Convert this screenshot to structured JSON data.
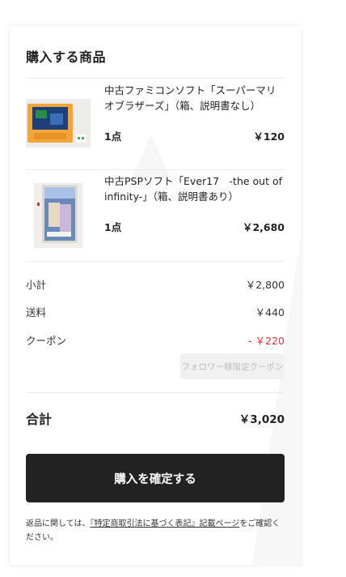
{
  "section_title": "購入する商品",
  "items": [
    {
      "name": "中古ファミコンソフト「スーパーマリオブラザーズ」（箱、説明書なし）",
      "qty": "1点",
      "price": "￥120",
      "image": "famicom-cartridge-photo"
    },
    {
      "name": "中古PSPソフト「Ever17　-the out of infinity-」（箱、説明書あり）",
      "qty": "1点",
      "price": "￥2,680",
      "image": "psp-game-case-photo"
    }
  ],
  "summary": {
    "subtotal_label": "小計",
    "subtotal_value": "￥2,800",
    "shipping_label": "送料",
    "shipping_value": "￥440",
    "coupon_label": "クーポン",
    "coupon_value": "- ￥220",
    "coupon_button": "フォロワー様限定クーポン"
  },
  "total": {
    "label": "合計",
    "value": "￥3,020"
  },
  "confirm_button": "購入を確定する",
  "notice": {
    "prefix": "返品に関しては、",
    "link": "『特定商取引法に基づく表記』記載ページ",
    "suffix": "をご確認ください。"
  },
  "colors": {
    "primary_button": "#222222",
    "discount": "#d0343a"
  }
}
